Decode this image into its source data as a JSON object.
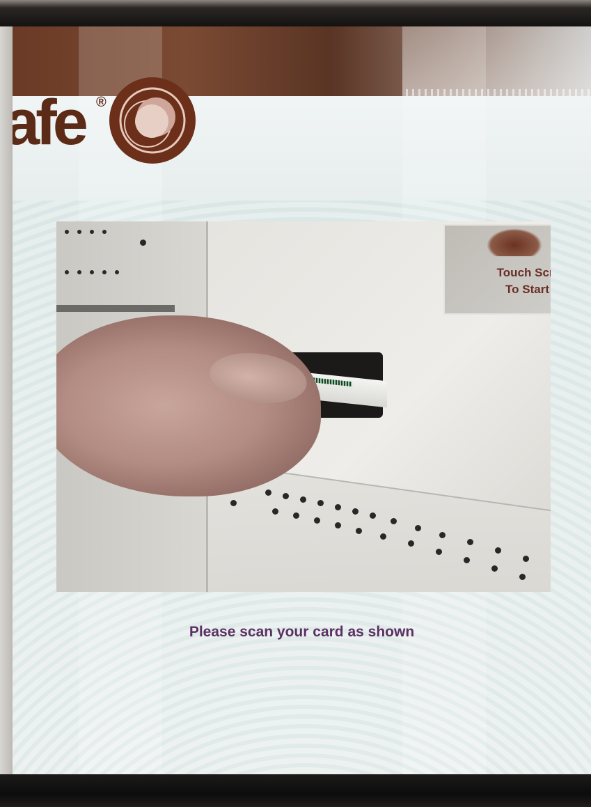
{
  "branding": {
    "logo_text": "afe",
    "registered_mark": "®",
    "brand_color": "#5c2b17"
  },
  "tutorial": {
    "sign_line1": "Touch Scre",
    "sign_line2": "To Start"
  },
  "instruction": {
    "text": "Please scan your card as shown",
    "color": "#5b3163"
  }
}
